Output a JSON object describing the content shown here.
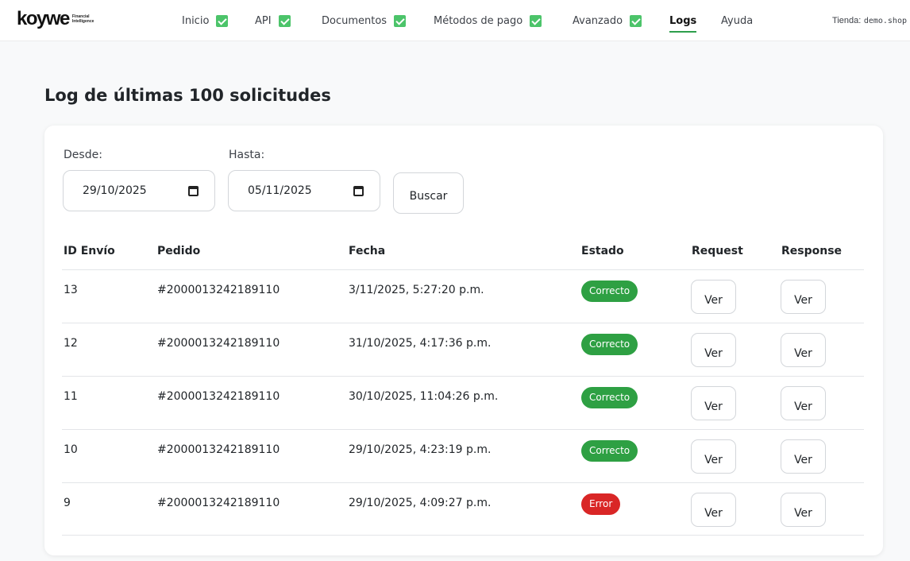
{
  "brand": {
    "name": "koywe",
    "tagline_1": "Financial",
    "tagline_2": "Intelligence"
  },
  "nav": {
    "items": [
      {
        "label": "Inicio",
        "check": true,
        "active": false
      },
      {
        "label": "API",
        "check": true,
        "active": false
      },
      {
        "label": "Documentos",
        "check": true,
        "active": false
      },
      {
        "label": "Métodos de pago",
        "check": true,
        "active": false
      },
      {
        "label": "Avanzado",
        "check": true,
        "active": false
      },
      {
        "label": "Logs",
        "check": false,
        "active": true
      },
      {
        "label": "Ayuda",
        "check": false,
        "active": false
      }
    ]
  },
  "store": {
    "label": "Tienda:",
    "value": "demo.shop"
  },
  "page": {
    "title": "Log de últimas 100 solicitudes"
  },
  "filters": {
    "from_label": "Desde:",
    "from_value": "29/10/2025",
    "to_label": "Hasta:",
    "to_value": "05/11/2025",
    "search_label": "Buscar"
  },
  "table": {
    "headers": [
      "ID Envío",
      "Pedido",
      "Fecha",
      "Estado",
      "Request",
      "Response"
    ],
    "rows": [
      {
        "id": "13",
        "order": "#2000013242189110",
        "date": "3/11/2025, 5:27:20 p.m.",
        "status": "Correcto",
        "request": "Ver",
        "response": "Ver"
      },
      {
        "id": "12",
        "order": "#2000013242189110",
        "date": "31/10/2025, 4:17:36 p.m.",
        "status": "Correcto",
        "request": "Ver",
        "response": "Ver"
      },
      {
        "id": "11",
        "order": "#2000013242189110",
        "date": "30/10/2025, 11:04:26 p.m.",
        "status": "Correcto",
        "request": "Ver",
        "response": "Ver"
      },
      {
        "id": "10",
        "order": "#2000013242189110",
        "date": "29/10/2025, 4:23:19 p.m.",
        "status": "Correcto",
        "request": "Ver",
        "response": "Ver"
      },
      {
        "id": "9",
        "order": "#2000013242189110",
        "date": "29/10/2025, 4:09:27 p.m.",
        "status": "Error",
        "request": "Ver",
        "response": "Ver"
      }
    ]
  },
  "colors": {
    "accent": "#2e9f4c",
    "check": "#4cc46a",
    "success": "#2ea043",
    "error": "#d92626"
  },
  "icons": {
    "nav_check": "check-square-icon",
    "date_picker": "calendar-icon"
  }
}
